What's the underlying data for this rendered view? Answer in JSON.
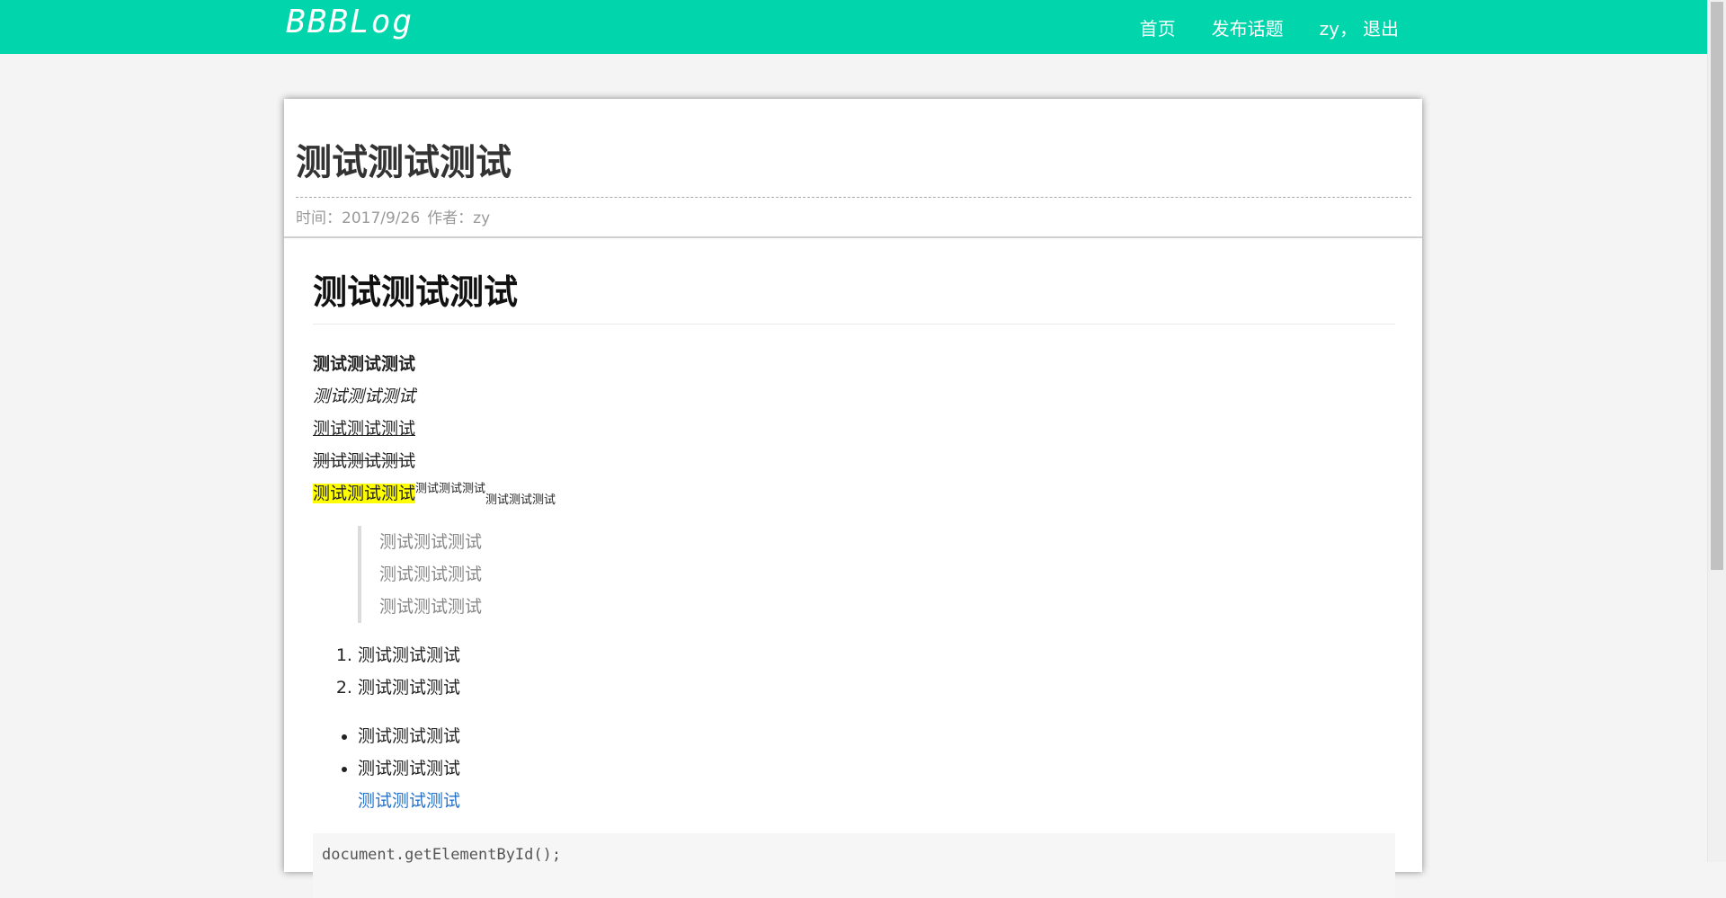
{
  "header": {
    "logo": "BBBLog",
    "nav": {
      "home": "首页",
      "publish": "发布话题",
      "user": "zy，",
      "logout": "退出"
    }
  },
  "post": {
    "title": "测试测试测试",
    "meta": {
      "time_label": "时间：2017/9/26",
      "author_label": "作者：zy"
    }
  },
  "content": {
    "heading": "测试测试测试",
    "bold": "测试测试测试",
    "italic": "测试测试测试",
    "underline": "测试测试测试",
    "strike": "测试测试测试",
    "mark": "测试测试测试",
    "sup": "测试测试测试",
    "sub": "测试测试测试",
    "quote": [
      "测试测试测试",
      "测试测试测试",
      "测试测试测试"
    ],
    "ordered": [
      "测试测试测试",
      "测试测试测试"
    ],
    "unordered": [
      "测试测试测试",
      "测试测试测试"
    ],
    "link": "测试测试测试",
    "code": "document.getElementById();"
  },
  "colors": {
    "header_bg": "#00d5ab",
    "link": "#2a72c8",
    "highlight": "#ffff00"
  }
}
